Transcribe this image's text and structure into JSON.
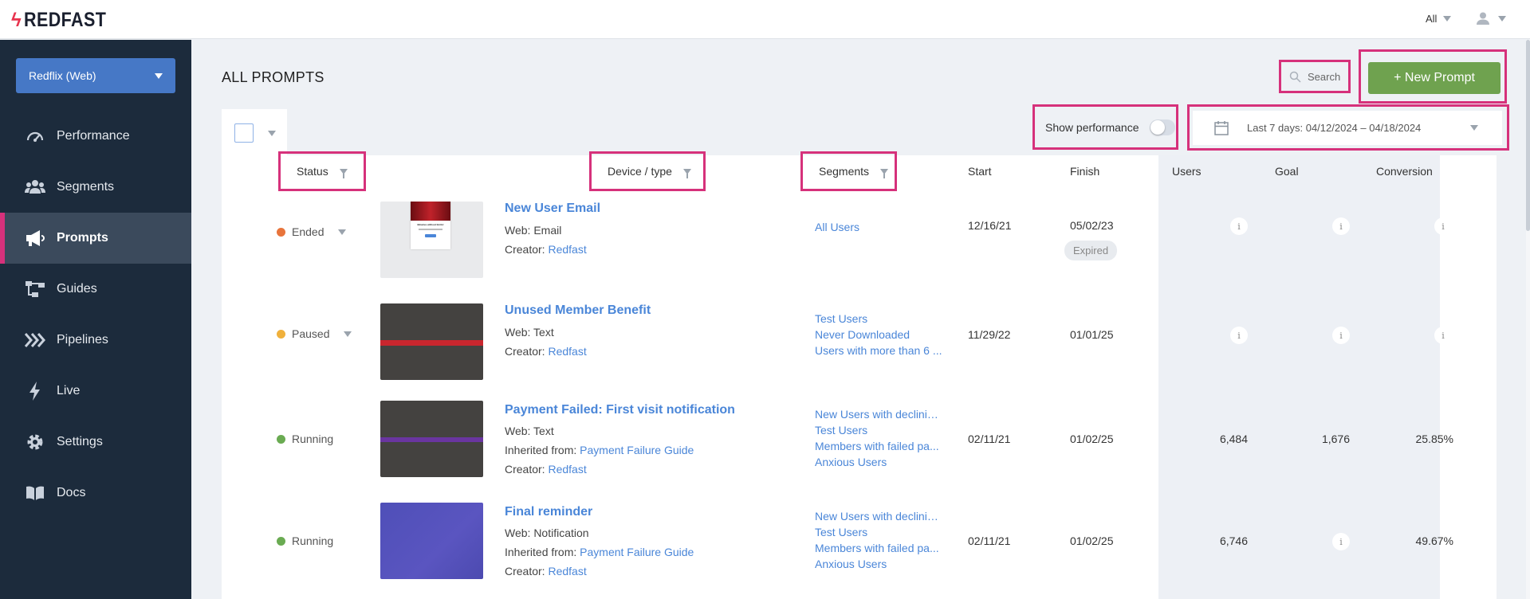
{
  "brand": {
    "name": "REDFAST"
  },
  "topbar": {
    "filter_label": "All"
  },
  "sidebar": {
    "app_select": "Redflix (Web)",
    "items": [
      {
        "label": "Performance",
        "icon": "gauge-icon"
      },
      {
        "label": "Segments",
        "icon": "users-icon"
      },
      {
        "label": "Prompts",
        "icon": "megaphone-icon",
        "active": true
      },
      {
        "label": "Guides",
        "icon": "flow-icon"
      },
      {
        "label": "Pipelines",
        "icon": "pipeline-icon"
      },
      {
        "label": "Live",
        "icon": "bolt-icon"
      },
      {
        "label": "Settings",
        "icon": "gear-icon"
      },
      {
        "label": "Docs",
        "icon": "book-icon"
      }
    ]
  },
  "main": {
    "title": "ALL PROMPTS",
    "search_placeholder": "Search",
    "new_button": "+ New Prompt",
    "show_performance": "Show performance",
    "date_range": "Last 7 days: 04/12/2024 – 04/18/2024"
  },
  "table": {
    "headers": {
      "status": "Status",
      "device": "Device / type",
      "segments": "Segments",
      "start": "Start",
      "finish": "Finish",
      "users": "Users",
      "goal": "Goal",
      "conversion": "Conversion"
    },
    "rows": [
      {
        "status": "Ended",
        "status_color": "#e8743b",
        "name": "New User Email",
        "type": "Web: Email",
        "inherited": "",
        "creator_label": "Creator:",
        "creator": "Redfast",
        "segments": [
          "All Users"
        ],
        "start": "12/16/21",
        "finish": "05/02/23",
        "badge": "Expired",
        "users": "",
        "goal": "",
        "conversion": ""
      },
      {
        "status": "Paused",
        "status_color": "#f0b13c",
        "name": "Unused Member Benefit",
        "type": "Web: Text",
        "inherited": "",
        "creator_label": "Creator:",
        "creator": "Redfast",
        "segments": [
          "Test Users",
          "Never Downloaded",
          "Users with more than 6 ..."
        ],
        "start": "11/29/22",
        "finish": "01/01/25",
        "badge": "",
        "users": "",
        "goal": "",
        "conversion": ""
      },
      {
        "status": "Running",
        "status_color": "#6aab52",
        "name": "Payment Failed: First visit notification",
        "type": "Web: Text",
        "inherited_label": "Inherited from:",
        "inherited": "Payment Failure Guide",
        "creator_label": "Creator:",
        "creator": "Redfast",
        "segments": [
          "New Users with declinin...",
          "Test Users",
          "Members with failed pa...",
          "Anxious Users"
        ],
        "start": "02/11/21",
        "finish": "01/02/25",
        "badge": "",
        "users": "6,484",
        "goal": "1,676",
        "conversion": "25.85%"
      },
      {
        "status": "Running",
        "status_color": "#6aab52",
        "name": "Final reminder",
        "type": "Web: Notification",
        "inherited_label": "Inherited from:",
        "inherited": "Payment Failure Guide",
        "creator_label": "Creator:",
        "creator": "Redfast",
        "segments": [
          "New Users with declinin...",
          "Test Users",
          "Members with failed pa...",
          "Anxious Users"
        ],
        "start": "02/11/21",
        "finish": "01/02/25",
        "badge": "",
        "users": "6,746",
        "goal": "",
        "conversion": "49.67%"
      }
    ],
    "info_glyph": "i"
  },
  "thumbnail_texts": {
    "email_heading": "Binaries without limits!"
  },
  "colors": {
    "accent": "#4a86d8",
    "brand": "#e8344e",
    "highlight": "#d6317b",
    "sidebar": "#1c2b3c",
    "new_button": "#6fa24f"
  }
}
